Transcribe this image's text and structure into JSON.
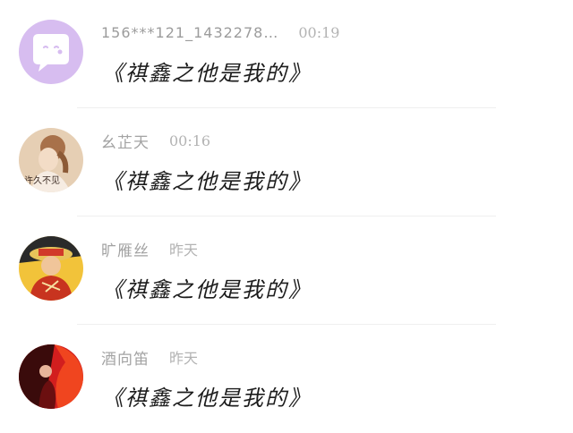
{
  "comments": [
    {
      "name": "156***121_1432278…",
      "time": "00:19",
      "message": "《祺鑫之他是我的》",
      "avatar": {
        "icon": "chat-bubble-face-icon",
        "bg": "#d7bdf0",
        "fg": "#ffffff"
      }
    },
    {
      "name": "幺芷天",
      "time": "00:16",
      "message": "《祺鑫之他是我的》",
      "avatar": {
        "icon": "portrait-photo",
        "caption": "许久不见",
        "bg": "#e6cfb4"
      }
    },
    {
      "name": "旷雁丝",
      "time": "昨天",
      "message": "《祺鑫之他是我的》",
      "avatar": {
        "icon": "anime-character-photo",
        "bg": "#c8341f"
      }
    },
    {
      "name": "酒向笛",
      "time": "昨天",
      "message": "《祺鑫之他是我的》",
      "avatar": {
        "icon": "red-dancer-photo",
        "bg": "#d21e1e"
      }
    }
  ]
}
